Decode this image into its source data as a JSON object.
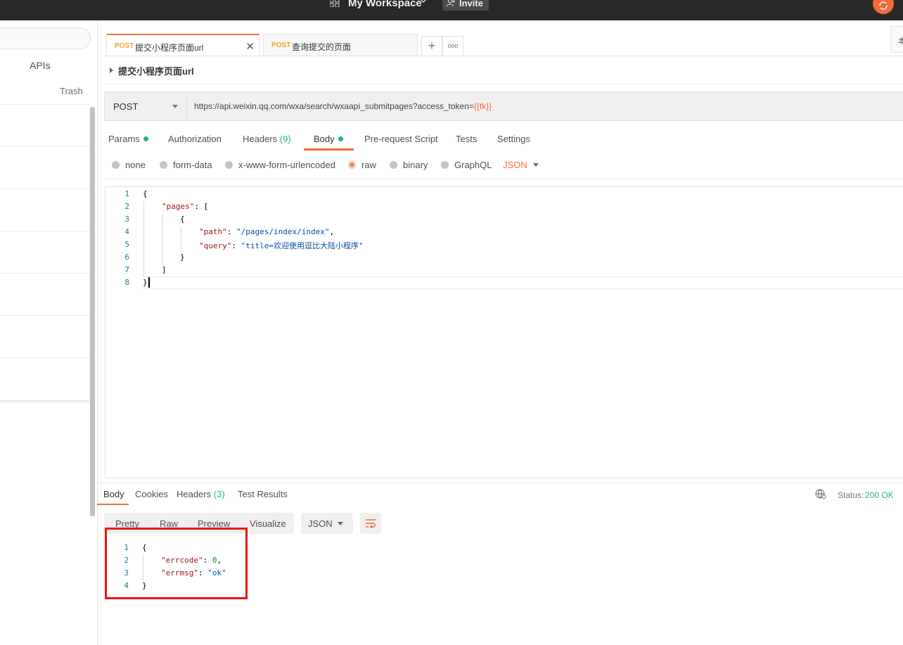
{
  "header": {
    "workspace": "My Workspace",
    "invite": "Invite"
  },
  "sidebar": {
    "apis": "APIs",
    "trash": "Trash"
  },
  "tabs": [
    {
      "method": "POST",
      "name": "提交小程序页面url",
      "close": "✕"
    },
    {
      "method": "POST",
      "name": "查询提交的页面"
    }
  ],
  "toolbar": {
    "add": "+",
    "more": "ooo",
    "right_label": "本"
  },
  "breadcrumb": "提交小程序页面url",
  "request": {
    "method": "POST",
    "url_prefix": "https://api.weixin.qq.com/wxa/search/wxaapi_submitpages?access_token=",
    "url_var": "{{tk}}"
  },
  "request_tabs": {
    "params": "Params",
    "authorization": "Authorization",
    "headers": "Headers",
    "headers_count": "(9)",
    "body": "Body",
    "prerequest": "Pre-request Script",
    "tests": "Tests",
    "settings": "Settings"
  },
  "body_modes": {
    "none": "none",
    "formdata": "form-data",
    "urlencoded": "x-www-form-urlencoded",
    "raw": "raw",
    "binary": "binary",
    "graphql": "GraphQL",
    "json": "JSON"
  },
  "editor": {
    "line_numbers": [
      "1",
      "2",
      "3",
      "4",
      "5",
      "6",
      "7",
      "8"
    ],
    "brace_open": "{",
    "pages_key": "\"pages\"",
    "colon_bracket": ": [",
    "obj_open": "{",
    "path_key": "\"path\"",
    "path_val": "\"/pages/index/index\"",
    "comma": ",",
    "colon": ": ",
    "query_key": "\"query\"",
    "query_val": "\"title=欢迎使用逗比大陆小程序\"",
    "obj_close": "}",
    "arr_close": "]",
    "brace_close": "}"
  },
  "response_tabs": {
    "body": "Body",
    "cookies": "Cookies",
    "headers": "Headers",
    "headers_count": "(3)",
    "test_results": "Test Results"
  },
  "status": {
    "label": "Status:",
    "value": "200 OK"
  },
  "response_formats": {
    "pretty": "Pretty",
    "raw": "Raw",
    "preview": "Preview",
    "visualize": "Visualize",
    "json": "JSON"
  },
  "response_body": {
    "line_numbers": [
      "1",
      "2",
      "3",
      "4"
    ],
    "brace_open": "{",
    "errcode_key": "\"errcode\"",
    "errcode_val": "0",
    "errmsg_key": "\"errmsg\"",
    "errmsg_val": "\"ok\"",
    "comma": ",",
    "colon": ": ",
    "brace_close": "}"
  },
  "colors": {
    "accent": "#f26b3a",
    "success": "#26b47f",
    "method_post": "#f4a433",
    "highlight_box": "#ee1111"
  }
}
